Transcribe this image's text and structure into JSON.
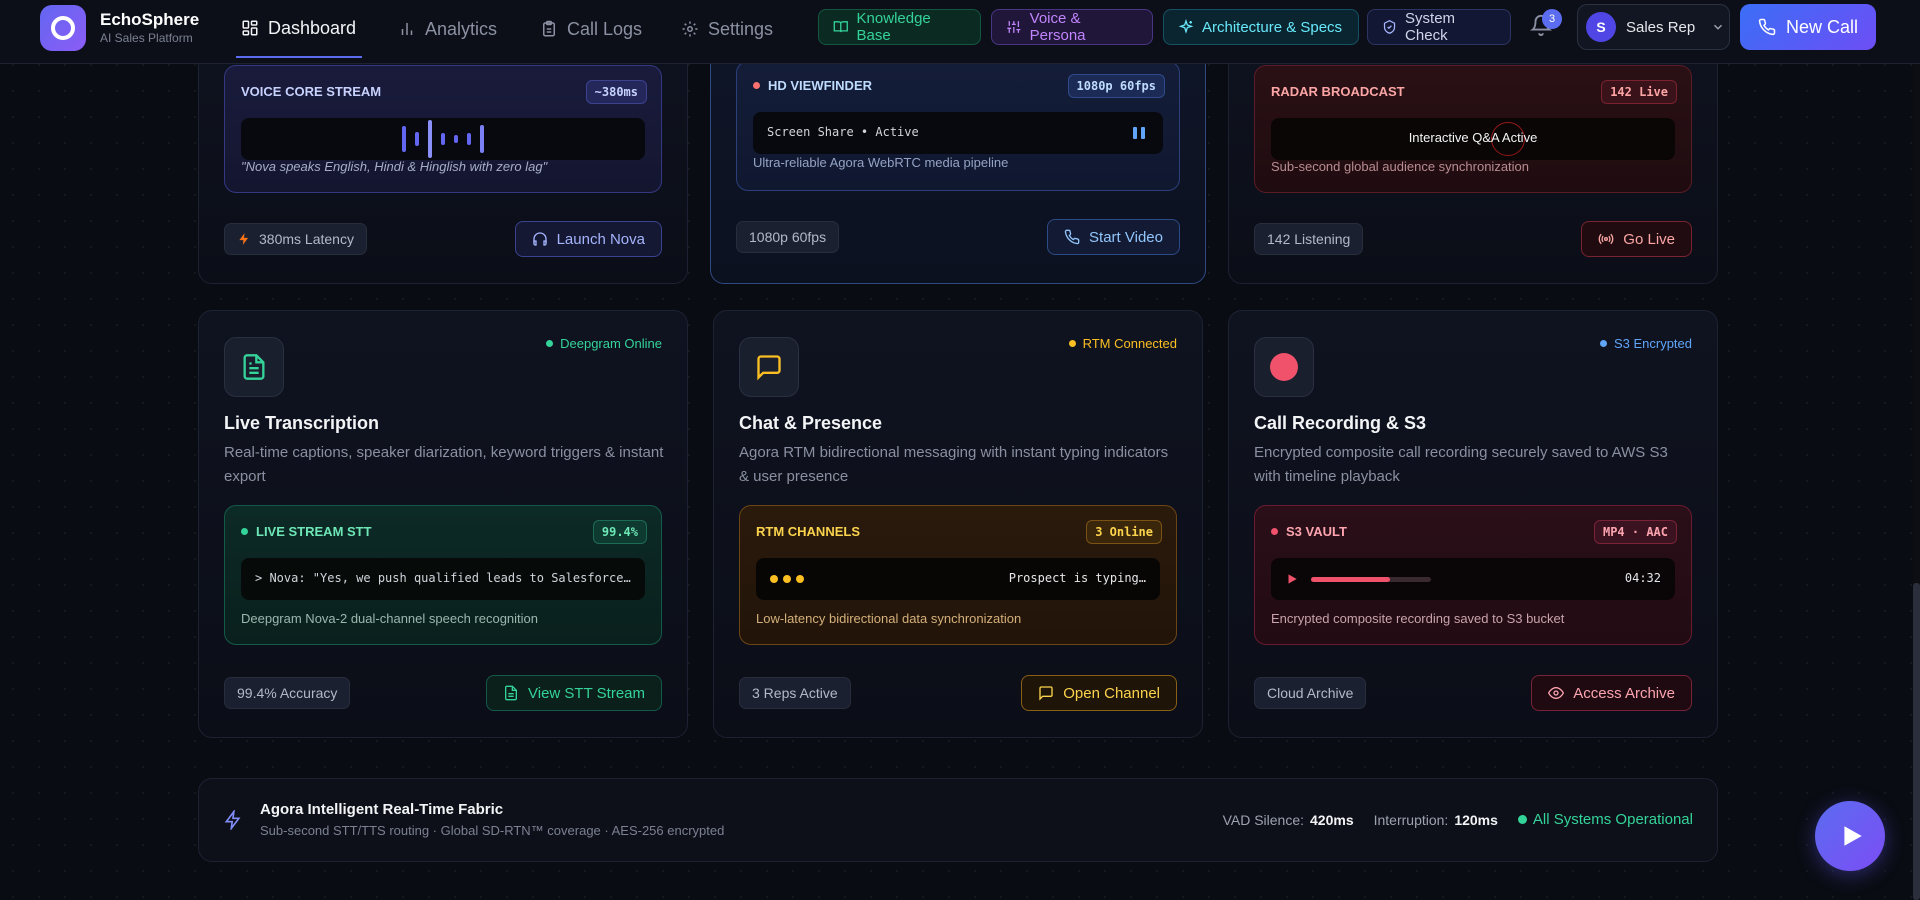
{
  "app": {
    "name": "EchoSphere",
    "subtitle": "AI Sales Platform"
  },
  "nav": [
    {
      "label": "Dashboard",
      "active": true,
      "icon": "grid-icon"
    },
    {
      "label": "Analytics",
      "active": false,
      "icon": "bar-chart-icon"
    },
    {
      "label": "Call Logs",
      "active": false,
      "icon": "clipboard-icon"
    },
    {
      "label": "Settings",
      "active": false,
      "icon": "gear-icon"
    }
  ],
  "pills": [
    {
      "label": "Knowledge Base",
      "icon": "book-icon",
      "color": "#34d399"
    },
    {
      "label": "Voice & Persona",
      "icon": "sliders-icon",
      "color": "#c084fc"
    },
    {
      "label": "Architecture & Specs",
      "icon": "sparkle-icon",
      "color": "#67e8f9"
    },
    {
      "label": "System Check",
      "icon": "shield-icon",
      "color": "#a5b4fc"
    }
  ],
  "notifications": {
    "count": "3"
  },
  "user": {
    "initial": "S",
    "role": "Sales Rep"
  },
  "new_call": {
    "label": "New Call"
  },
  "top_cards": [
    {
      "inner_title": "VOICE CORE STREAM",
      "inner_tag": "~380ms",
      "inner_footer": "\"Nova speaks English, Hindi & Hinglish with zero lag\"",
      "stat": "380ms Latency",
      "button": "Launch Nova",
      "accent": "#818cf8"
    },
    {
      "inner_title": "HD VIEWFINDER",
      "inner_tag": "1080p 60fps",
      "inner_bar_text": "Screen Share • Active",
      "inner_footer": "Ultra-reliable Agora WebRTC media pipeline",
      "stat": "1080p 60fps",
      "button": "Start Video",
      "accent": "#60a5fa"
    },
    {
      "inner_title": "RADAR BROADCAST",
      "inner_tag": "142 Live",
      "inner_bar_text": "Interactive Q&A Active",
      "inner_footer": "Sub-second global audience synchronization",
      "stat": "142 Listening",
      "button": "Go Live",
      "accent": "#f87171"
    }
  ],
  "feature_cards": [
    {
      "status": "Deepgram Online",
      "status_color": "#34d399",
      "icon": "document-icon",
      "title": "Live Transcription",
      "description": "Real-time captions, speaker diarization, keyword triggers & instant export",
      "inner_title": "LIVE STREAM STT",
      "inner_tag": "99.4%",
      "inner_bar_text": "> Nova: \"Yes, we push qualified leads to Salesforce…",
      "inner_footer": "Deepgram Nova-2 dual-channel speech recognition",
      "stat": "99.4% Accuracy",
      "button": "View STT Stream"
    },
    {
      "status": "RTM Connected",
      "status_color": "#fbbf24",
      "icon": "chat-icon",
      "title": "Chat & Presence",
      "description": "Agora RTM bidirectional messaging with instant typing indicators & user presence",
      "inner_title": "RTM CHANNELS",
      "inner_tag": "3 Online",
      "inner_bar_text": "Prospect is typing…",
      "inner_footer": "Low-latency bidirectional data synchronization",
      "stat": "3 Reps Active",
      "button": "Open Channel"
    },
    {
      "status": "S3 Encrypted",
      "status_color": "#60a5fa",
      "icon": "record-icon",
      "title": "Call Recording & S3",
      "description": "Encrypted composite call recording securely saved to AWS S3 with timeline playback",
      "inner_title": "S3 VAULT",
      "inner_tag": "MP4 · AAC",
      "inner_bar_text": "04:32",
      "playback_progress": 0.66,
      "inner_footer": "Encrypted composite recording saved to S3 bucket",
      "stat": "Cloud Archive",
      "button": "Access Archive"
    }
  ],
  "footer": {
    "title": "Agora Intelligent Real-Time Fabric",
    "subtitle": "Sub-second STT/TTS routing · Global SD-RTN™ coverage · AES-256 encrypted",
    "vad_label": "VAD Silence:",
    "vad_value": "420ms",
    "interrupt_label": "Interruption:",
    "interrupt_value": "120ms",
    "status": "All Systems Operational"
  }
}
